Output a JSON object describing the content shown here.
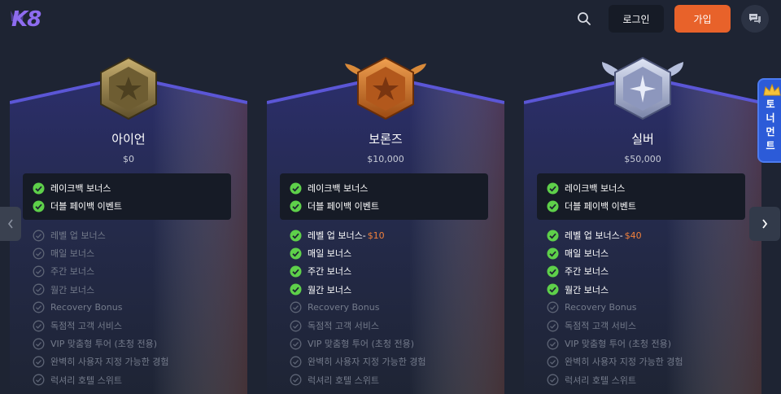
{
  "header": {
    "logo_text": "K8",
    "login_label": "로그인",
    "join_label": "가입",
    "icons": {
      "search": "search-icon",
      "chat": "chat-icon"
    }
  },
  "colors": {
    "background": "#1e2433",
    "accent_orange": "#e8622a",
    "check_green": "#5ed04a",
    "amount_orange": "#f0803c"
  },
  "tournament_tab": {
    "label": "토너먼트"
  },
  "tiers": [
    {
      "name": "아이언",
      "amount": "$0",
      "badge": "iron-badge-icon",
      "highlights": [
        "레이크백 보너스",
        "더블 페이백 이벤트"
      ],
      "features": [
        {
          "label": "레벨 업 보너스",
          "amount": "",
          "enabled": false
        },
        {
          "label": "매일 보너스",
          "amount": "",
          "enabled": false
        },
        {
          "label": "주간 보너스",
          "amount": "",
          "enabled": false
        },
        {
          "label": "월간 보너스",
          "amount": "",
          "enabled": false
        },
        {
          "label": "Recovery Bonus",
          "amount": "",
          "enabled": false
        },
        {
          "label": "독점적 고객 서비스",
          "amount": "",
          "enabled": false
        },
        {
          "label": "VIP 맞춤형 투어 (초청 전용)",
          "amount": "",
          "enabled": false
        },
        {
          "label": "완벽히 사용자 지정 가능한 경험",
          "amount": "",
          "enabled": false
        },
        {
          "label": "럭셔리 호텔 스위트",
          "amount": "",
          "enabled": false
        }
      ]
    },
    {
      "name": "보론즈",
      "amount": "$10,000",
      "badge": "bronze-badge-icon",
      "highlights": [
        "레이크백 보너스",
        "더블 페이백 이벤트"
      ],
      "features": [
        {
          "label": "레벨 업 보너스-",
          "amount": "$10",
          "enabled": true
        },
        {
          "label": "매일 보너스",
          "amount": "",
          "enabled": true
        },
        {
          "label": "주간 보너스",
          "amount": "",
          "enabled": true
        },
        {
          "label": "월간 보너스",
          "amount": "",
          "enabled": true
        },
        {
          "label": "Recovery Bonus",
          "amount": "",
          "enabled": false
        },
        {
          "label": "독점적 고객 서비스",
          "amount": "",
          "enabled": false
        },
        {
          "label": "VIP 맞춤형 투어 (초청 전용)",
          "amount": "",
          "enabled": false
        },
        {
          "label": "완벽히 사용자 지정 가능한 경험",
          "amount": "",
          "enabled": false
        },
        {
          "label": "럭셔리 호텔 스위트",
          "amount": "",
          "enabled": false
        }
      ]
    },
    {
      "name": "실버",
      "amount": "$50,000",
      "badge": "silver-badge-icon",
      "highlights": [
        "레이크백 보너스",
        "더블 페이백 이벤트"
      ],
      "features": [
        {
          "label": "레벨 업 보너스-",
          "amount": "$40",
          "enabled": true
        },
        {
          "label": "매일 보너스",
          "amount": "",
          "enabled": true
        },
        {
          "label": "주간 보너스",
          "amount": "",
          "enabled": true
        },
        {
          "label": "월간 보너스",
          "amount": "",
          "enabled": true
        },
        {
          "label": "Recovery Bonus",
          "amount": "",
          "enabled": false
        },
        {
          "label": "독점적 고객 서비스",
          "amount": "",
          "enabled": false
        },
        {
          "label": "VIP 맞춤형 투어 (초청 전용)",
          "amount": "",
          "enabled": false
        },
        {
          "label": "완벽히 사용자 지정 가능한 경험",
          "amount": "",
          "enabled": false
        },
        {
          "label": "럭셔리 호텔 스위트",
          "amount": "",
          "enabled": false
        }
      ]
    }
  ]
}
